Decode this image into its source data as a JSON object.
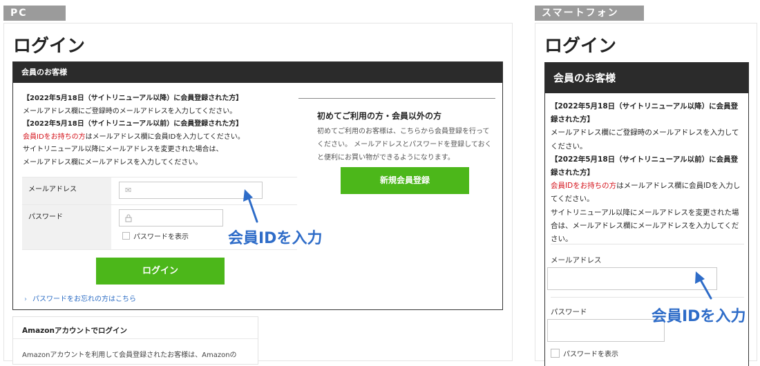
{
  "tags": {
    "pc": "PC",
    "smartphone": "スマートフォン"
  },
  "pc": {
    "page_title": "ログイン",
    "box_header": "会員のお客様",
    "notice": {
      "line1": "【2022年5月18日（サイトリニューアル以降）に会員登録された方】",
      "line2": "メールアドレス欄にご登録時のメールアドレスを入力してください。",
      "line3": "【2022年5月18日（サイトリニューアル以前）に会員登録された方】",
      "line4_red": "会員IDをお持ちの方",
      "line4_rest": "はメールアドレス欄に会員IDを入力してください。",
      "line5": "サイトリニューアル以降にメールアドレスを変更された場合は、",
      "line6": "メールアドレス欄にメールアドレスを入力してください。"
    },
    "form": {
      "email_label": "メールアドレス",
      "password_label": "パスワード",
      "show_password": "パスワードを表示"
    },
    "login_button": "ログイン",
    "forgot_link": "パスワードをお忘れの方はこちら",
    "first_time": {
      "title": "初めてご利用の方・会員以外の方",
      "text": "初めてご利用のお客様は、こちらから会員登録を行ってください。 メールアドレスとパスワードを登録しておくと便利にお買い物ができるようになります。",
      "register_button": "新規会員登録"
    },
    "amazon": {
      "title": "Amazonアカウントでログイン",
      "text": "Amazonアカウントを利用して会員登録されたお客様は、Amazonの"
    },
    "annotation": "会員IDを入力"
  },
  "smartphone": {
    "page_title": "ログイン",
    "box_header": "会員のお客様",
    "notice": {
      "line1": "【2022年5月18日（サイトリニューアル以降）に会員登録された方】",
      "line2": "メールアドレス欄にご登録時のメールアドレスを入力してください。",
      "line3": "【2022年5月18日（サイトリニューアル以前）に会員登録された方】",
      "line4_red": "会員IDをお持ちの方",
      "line4_rest": "はメールアドレス欄に会員IDを入力してください。",
      "line5": "サイトリニューアル以降にメールアドレスを変更された場合は、メールアドレス欄にメールアドレスを入力してください。"
    },
    "form": {
      "email_label": "メールアドレス",
      "password_label": "パスワード",
      "show_password": "パスワードを表示"
    },
    "annotation": "会員IDを入力"
  },
  "colors": {
    "accent_green": "#4cb71a",
    "annotation_blue": "#2e6cc8",
    "notice_red": "#d4131b",
    "header_dark": "#2b2b2b"
  }
}
